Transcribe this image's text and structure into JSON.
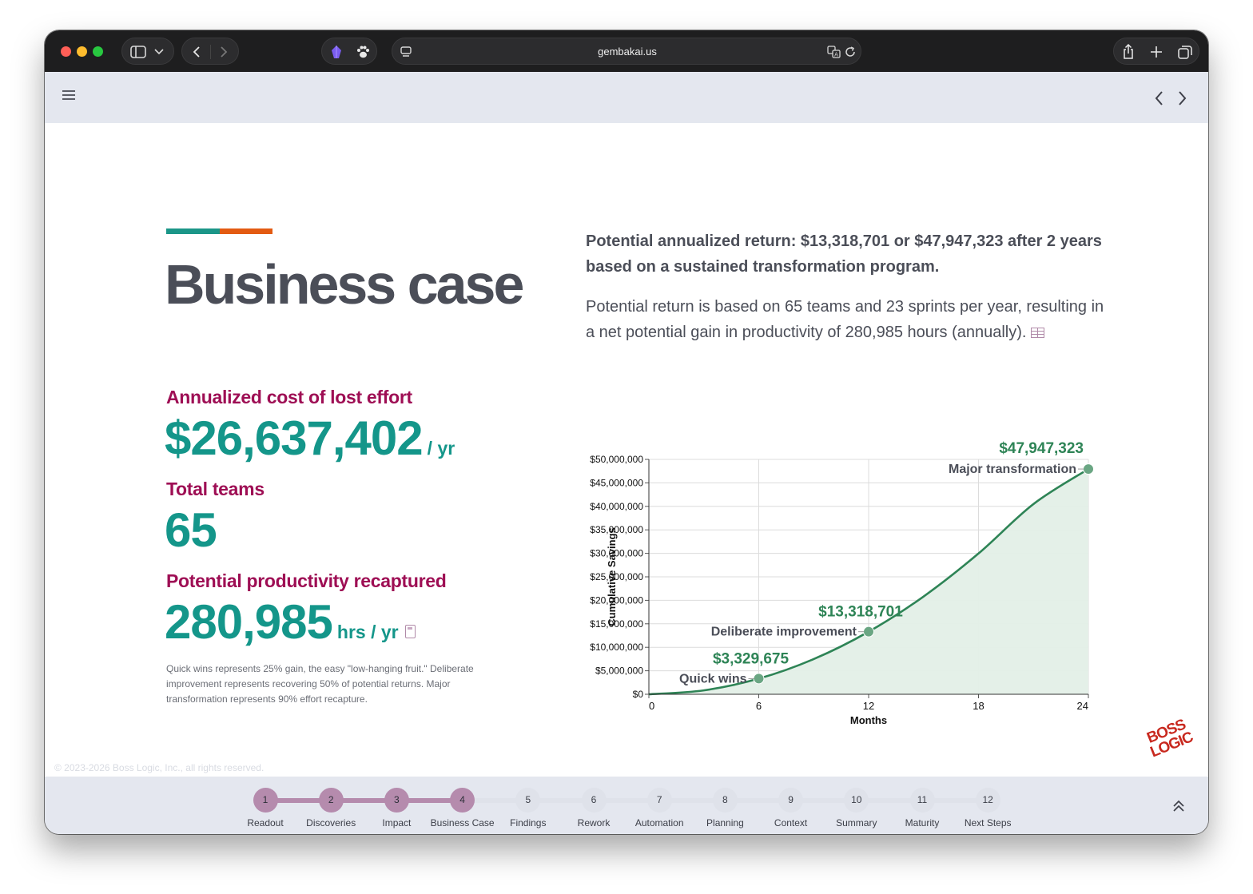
{
  "browser": {
    "url": "gembakai.us"
  },
  "page": {
    "title": "Business case",
    "summary_bold": "Potential annualized return: $13,318,701 or $47,947,323 after 2 years based on a sustained transformation program.",
    "summary": "Potential return is based on 65 teams and 23 sprints per year, resulting in a net potential gain in productivity of 280,985 hours (annually).",
    "metrics": {
      "cost_label": "Annualized cost of lost effort",
      "cost_value": "$26,637,402",
      "cost_unit": "/ yr",
      "teams_label": "Total teams",
      "teams_value": "65",
      "productivity_label": "Potential productivity recaptured",
      "productivity_value": "280,985",
      "productivity_unit": "hrs / yr"
    },
    "note": "Quick wins represents 25% gain, the easy \"low-hanging fruit.\" Deliberate improvement represents recovering 50% of potential returns. Major transformation represents 90% effort recapture.",
    "copyright": "© 2023-2026 Boss Logic, Inc., all rights reserved.",
    "logo_text": [
      "BOSS",
      "LOGIC"
    ]
  },
  "chart_data": {
    "type": "area",
    "xlabel": "Months",
    "ylabel": "Cumulative Savings",
    "xlim": [
      0,
      24
    ],
    "ylim": [
      0,
      50000000
    ],
    "x_ticks": [
      "0",
      "6",
      "12",
      "18",
      "24"
    ],
    "y_ticks": [
      "$0",
      "$5,000,000",
      "$10,000,000",
      "$15,000,000",
      "$20,000,000",
      "$25,000,000",
      "$30,000,000",
      "$35,000,000",
      "$40,000,000",
      "$45,000,000",
      "$50,000,000"
    ],
    "grid": true,
    "series": [
      {
        "x": [
          0,
          3,
          6,
          9,
          12,
          15,
          18,
          21,
          24
        ],
        "y": [
          0,
          832419,
          3329675,
          7491769,
          13318701,
          20810470,
          29967077,
          40488522,
          47947323
        ]
      }
    ],
    "milestones": [
      {
        "x": 6,
        "y": 3329675,
        "label": "Quick wins",
        "value_label": "$3,329,675"
      },
      {
        "x": 12,
        "y": 13318701,
        "label": "Deliberate improvement",
        "value_label": "$13,318,701"
      },
      {
        "x": 24,
        "y": 47947323,
        "label": "Major transformation",
        "value_label": "$47,947,323"
      }
    ],
    "colors": {
      "line": "#2e8456",
      "fill": "#e3efe7",
      "point": "#6aa683",
      "value_text": "#2e8456",
      "label_text": "#4b4e58"
    }
  },
  "stepper": {
    "steps": [
      {
        "num": "1",
        "label": "Readout",
        "done": true
      },
      {
        "num": "2",
        "label": "Discoveries",
        "done": true
      },
      {
        "num": "3",
        "label": "Impact",
        "done": true
      },
      {
        "num": "4",
        "label": "Business Case",
        "done": true
      },
      {
        "num": "5",
        "label": "Findings",
        "done": false
      },
      {
        "num": "6",
        "label": "Rework",
        "done": false
      },
      {
        "num": "7",
        "label": "Automation",
        "done": false
      },
      {
        "num": "8",
        "label": "Planning",
        "done": false
      },
      {
        "num": "9",
        "label": "Context",
        "done": false
      },
      {
        "num": "10",
        "label": "Summary",
        "done": false
      },
      {
        "num": "11",
        "label": "Maturity",
        "done": false
      },
      {
        "num": "12",
        "label": "Next Steps",
        "done": false
      }
    ],
    "colors": {
      "done": "#b58bad",
      "todo": "#dfe2ea"
    }
  }
}
